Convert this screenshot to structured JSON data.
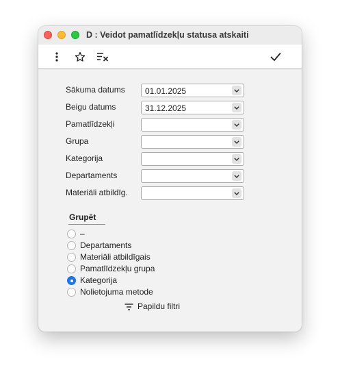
{
  "window": {
    "title": "D : Veidot pamatlīdzekļu statusa atskaiti"
  },
  "toolbar": {
    "icons": [
      "more-vertical-icon",
      "star-icon",
      "clear-filter-icon",
      "checkmark-icon"
    ]
  },
  "form": {
    "fields": [
      {
        "label": "Sākuma datums",
        "value": "01.01.2025"
      },
      {
        "label": "Beigu datums",
        "value": "31.12.2025"
      },
      {
        "label": "Pamatlīdzekļi",
        "value": ""
      },
      {
        "label": "Grupa",
        "value": ""
      },
      {
        "label": "Kategorija",
        "value": ""
      },
      {
        "label": "Departaments",
        "value": ""
      },
      {
        "label": "Materiāli atbildīg.",
        "value": ""
      }
    ]
  },
  "group": {
    "title": "Grupēt",
    "options": [
      {
        "label": "–",
        "selected": false
      },
      {
        "label": "Departaments",
        "selected": false
      },
      {
        "label": "Materiāli atbildīgais",
        "selected": false
      },
      {
        "label": "Pamatlīdzekļu grupa",
        "selected": false
      },
      {
        "label": "Kategorija",
        "selected": true
      },
      {
        "label": "Nolietojuma metode",
        "selected": false
      }
    ],
    "extra_filters_label": "Papildu filtri"
  },
  "colors": {
    "accent": "#1a73f0",
    "underline": "#6ab04c"
  }
}
